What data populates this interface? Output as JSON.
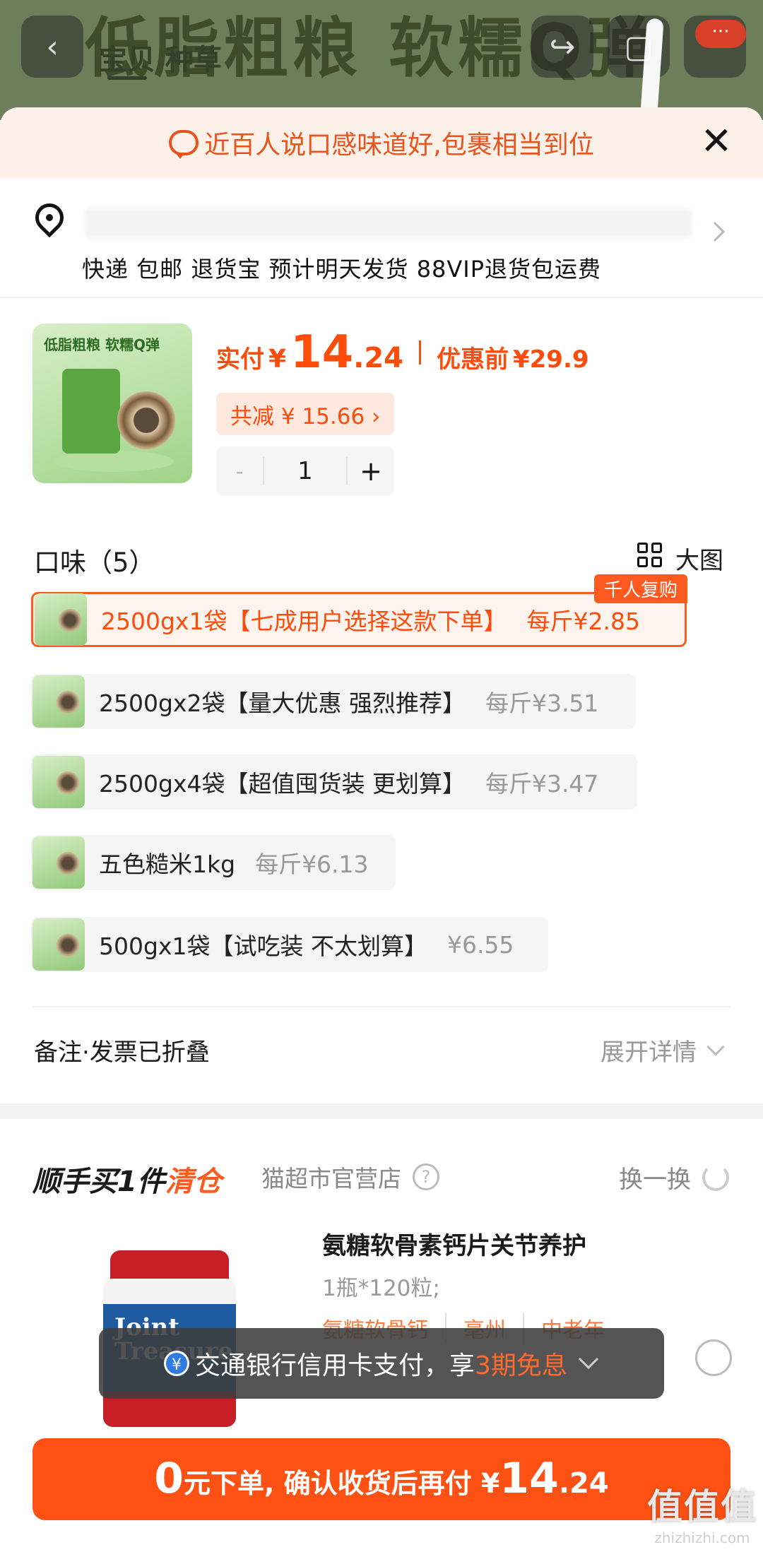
{
  "background": {
    "banner_text": "低脂粗粮 软糯Q弹",
    "tab_label": "宝贝",
    "tab_label_2": "种草",
    "more_badge": "···"
  },
  "notice": {
    "text": "近百人说口感味道好,包裹相当到位"
  },
  "address": {
    "delivery_line": "快递 包邮 退货宝 预计明天发货 88VIP退货包运费"
  },
  "product": {
    "thumb_title": "低脂粗粮 软糯Q弹",
    "pay_label": "实付",
    "currency": "¥",
    "price_int": "14",
    "price_dec": ".24",
    "original_label": "优惠前",
    "original_price": "¥29.9",
    "discount": "共减 ¥ 15.66 ›",
    "quantity": "1",
    "minus": "-",
    "plus": "+"
  },
  "flavor": {
    "title": "口味（5）",
    "big_picture_label": "大图",
    "options": [
      {
        "name": "2500gx1袋【七成用户选择这款下单】",
        "price": "每斤¥2.85",
        "badge": "千人复购",
        "selected": true
      },
      {
        "name": "2500gx2袋【量大优惠 强烈推荐】",
        "price": "每斤¥3.51",
        "selected": false
      },
      {
        "name": "2500gx4袋【超值囤货装 更划算】",
        "price": "每斤¥3.47",
        "selected": false
      },
      {
        "name": "五色糙米1kg",
        "price": "每斤¥6.13",
        "selected": false
      },
      {
        "name": "500gx1袋【试吃装 不太划算】",
        "price": "¥6.55",
        "selected": false
      }
    ]
  },
  "remark": {
    "label": "备注·发票已折叠",
    "expand_label": "展开详情"
  },
  "upsell": {
    "title_prefix": "顺手买1件",
    "title_highlight": "清仓",
    "shop": "猫超市官营店",
    "swap_label": "换一换",
    "item_name": "氨糖软骨素钙片关节养护",
    "item_spec": "1瓶*120粒;",
    "tags": [
      "氨糖软骨钙",
      "亳州",
      "中老年"
    ],
    "bottle_label": "Joint Treasure"
  },
  "toast": {
    "prefix": "交通银行信用卡支付，享",
    "highlight": "3期免息",
    "icon": "¥"
  },
  "cta": {
    "zero": "0",
    "middle": "元下单, 确认收货后再付 ¥",
    "amount_int": "14",
    "amount_dec": ".24"
  },
  "watermark": {
    "brand": "值值值",
    "domain": "zhizhizhi.com"
  },
  "colors": {
    "accent": "#ff5113",
    "highlight_bg": "#fdf1ea"
  }
}
